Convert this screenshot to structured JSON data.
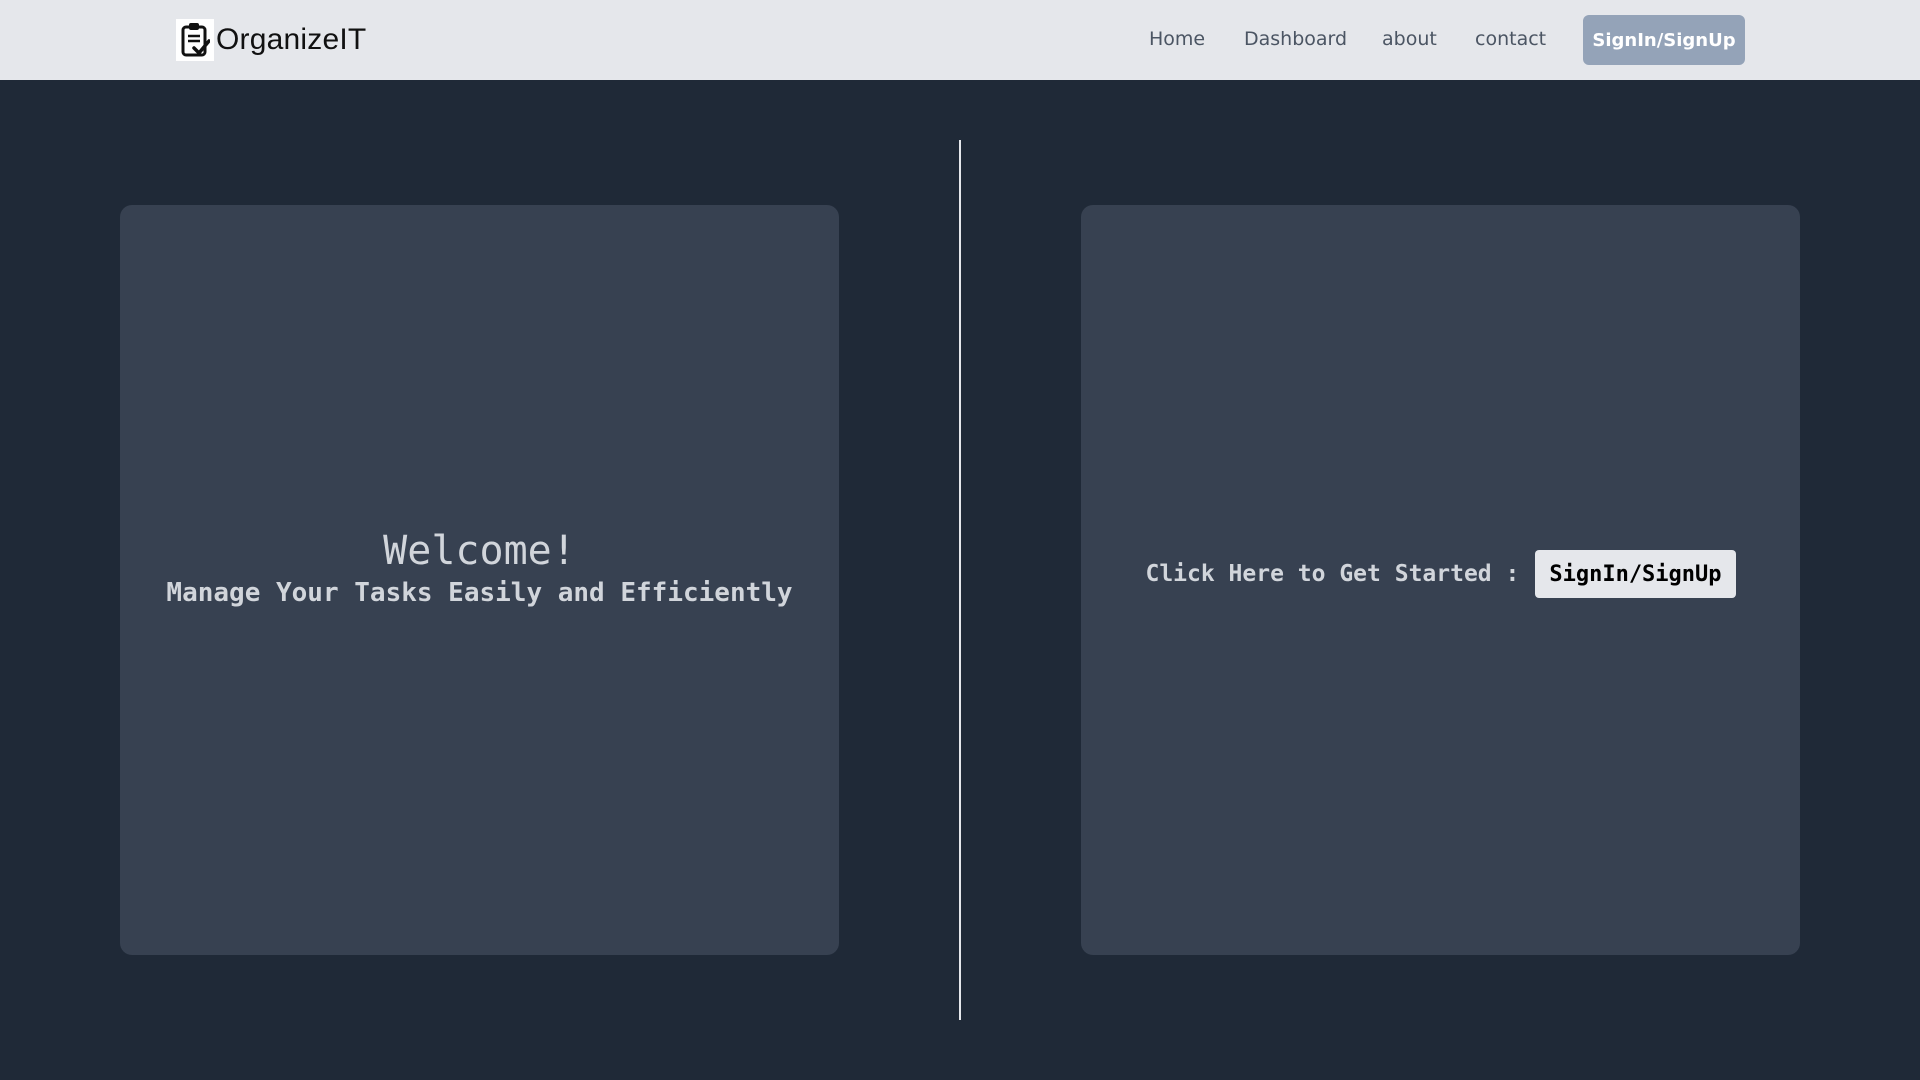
{
  "navbar": {
    "brand_name": "OrganizeIT",
    "brand_icon": "clipboard-check-icon",
    "links": [
      {
        "label": "Home"
      },
      {
        "label": "Dashboard"
      },
      {
        "label": "about"
      },
      {
        "label": "contact"
      }
    ],
    "auth_button_label": "SignIn/SignUp"
  },
  "welcome_panel": {
    "title": "Welcome!",
    "subtitle": "Manage Your Tasks Easily and Efficiently"
  },
  "cta_panel": {
    "prompt": "Click Here to Get Started :",
    "button_label": "SignIn/SignUp"
  },
  "colors": {
    "navbar_bg": "#e5e7eb",
    "page_bg": "#1f2937",
    "panel_bg": "#374151",
    "nav_button_bg": "#94a3b8",
    "text_light": "#d1d5db"
  }
}
